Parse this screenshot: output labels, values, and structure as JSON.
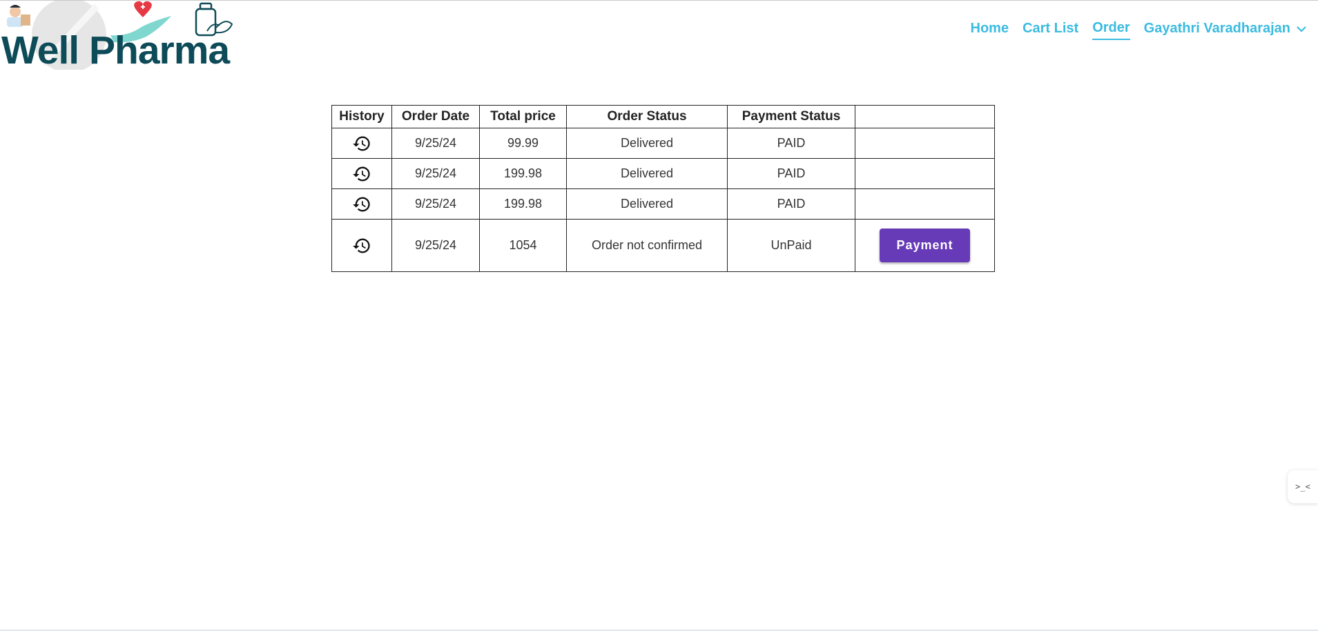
{
  "brand": {
    "name": "Well Pharma",
    "colors": {
      "dark_teal": "#0e4b58",
      "accent": "#3bbbe0",
      "heart": "#e53945"
    }
  },
  "nav": {
    "items": [
      {
        "label": "Home",
        "active": false
      },
      {
        "label": "Cart List",
        "active": false
      },
      {
        "label": "Order",
        "active": true
      }
    ],
    "user_name": "Gayathri Varadharajan",
    "user_icon": "chevron-down-icon"
  },
  "orders": {
    "headers": [
      "History",
      "Order Date",
      "Total price",
      "Order Status",
      "Payment Status",
      ""
    ],
    "rows": [
      {
        "history_icon": "history-icon",
        "date": "9/25/24",
        "total": "99.99",
        "status": "Delivered",
        "payment": "PAID",
        "action": ""
      },
      {
        "history_icon": "history-icon",
        "date": "9/25/24",
        "total": "199.98",
        "status": "Delivered",
        "payment": "PAID",
        "action": ""
      },
      {
        "history_icon": "history-icon",
        "date": "9/25/24",
        "total": "199.98",
        "status": "Delivered",
        "payment": "PAID",
        "action": ""
      },
      {
        "history_icon": "history-icon",
        "date": "9/25/24",
        "total": "1054",
        "status": "Order not confirmed",
        "payment": "UnPaid",
        "action": "Payment"
      }
    ],
    "button_color": "#673ab7"
  },
  "side_widget": {
    "glyph": ">_<",
    "icon": "assistant-widget-icon"
  }
}
